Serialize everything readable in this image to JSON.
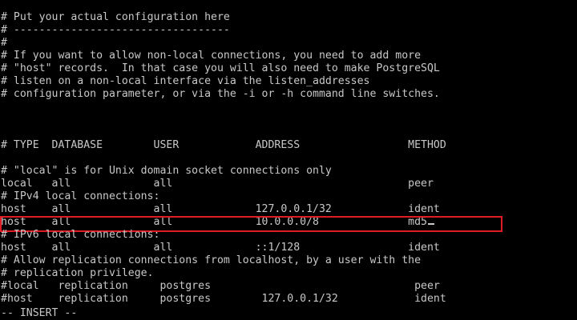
{
  "editor": {
    "lines": [
      "# Put your actual configuration here",
      "# ----------------------------------",
      "#",
      "# If you want to allow non-local connections, you need to add more",
      "# \"host\" records.  In that case you will also need to make PostgreSQL",
      "# listen on a non-local interface via the listen_addresses",
      "# configuration parameter, or via the -i or -h command line switches.",
      "",
      "",
      "",
      "# TYPE  DATABASE        USER            ADDRESS                 METHOD",
      "",
      "# \"local\" is for Unix domain socket connections only",
      "local   all             all                                     peer",
      "# IPv4 local connections:",
      "host    all             all             127.0.0.1/32            ident",
      "host    all             all             10.0.0.0/8              md5",
      "# IPv6 local connections:",
      "host    all             all             ::1/128                 ident",
      "# Allow replication connections from localhost, by a user with the",
      "# replication privilege.",
      "#local   replication     postgres                                peer",
      "#host    replication     postgres        127.0.0.1/32            ident"
    ],
    "status": "-- INSERT --",
    "highlight_color": "#e01b24",
    "text_color": "#c8c8c8",
    "background_color": "#000000"
  }
}
